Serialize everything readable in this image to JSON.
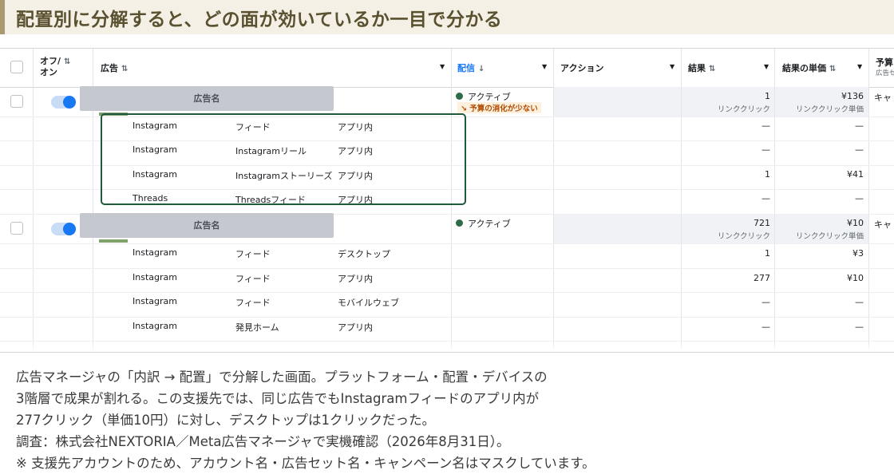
{
  "heading": "配置別に分解すると、どの面が効いているか一目で分かる",
  "columns": {
    "onoff": "オフ/\nオン",
    "onoff_line1": "オフ/",
    "onoff_line2": "オン",
    "ad": "広告",
    "delivery": "配信",
    "action": "アクション",
    "results": "結果",
    "cost_per_result": "結果の単価",
    "budget": "予算",
    "budget_sub": "広告セ"
  },
  "ads": [
    {
      "name": "広告名",
      "status": "アクティブ",
      "warning": "予算の消化が少ない",
      "result": "1",
      "result_unit": "リンククリック",
      "cost": "¥136",
      "cost_unit": "リンククリック単価",
      "budget": "キャ",
      "rows": [
        {
          "platform": "Instagram",
          "placement": "フィード",
          "device": "アプリ内",
          "result": "—",
          "cost": "—"
        },
        {
          "platform": "Instagram",
          "placement": "Instagramリール",
          "device": "アプリ内",
          "result": "—",
          "cost": "—"
        },
        {
          "platform": "Instagram",
          "placement": "Instagramストーリーズ",
          "device": "アプリ内",
          "result": "1",
          "cost": "¥41"
        },
        {
          "platform": "Threads",
          "placement": "Threadsフィード",
          "device": "アプリ内",
          "result": "—",
          "cost": "—"
        }
      ]
    },
    {
      "name": "広告名",
      "status": "アクティブ",
      "result": "721",
      "result_unit": "リンククリック",
      "cost": "¥10",
      "cost_unit": "リンククリック単価",
      "budget": "キャ",
      "rows": [
        {
          "platform": "Instagram",
          "placement": "フィード",
          "device": "デスクトップ",
          "result": "1",
          "cost": "¥3"
        },
        {
          "platform": "Instagram",
          "placement": "フィード",
          "device": "アプリ内",
          "result": "277",
          "cost": "¥10"
        },
        {
          "platform": "Instagram",
          "placement": "フィード",
          "device": "モバイルウェブ",
          "result": "—",
          "cost": "—"
        },
        {
          "platform": "Instagram",
          "placement": "発見ホーム",
          "device": "アプリ内",
          "result": "—",
          "cost": "—"
        }
      ]
    }
  ],
  "caption": [
    "広告マネージャの「内訳 → 配置」で分解した画面。プラットフォーム・配置・デバイスの",
    "3階層で成果が割れる。この支援先では、同じ広告でもInstagramフィードのアプリ内が",
    "277クリック（単価10円）に対し、デスクトップは1クリックだった。",
    "調査：株式会社NEXTORIA／Meta広告マネージャで実機確認（2026年8月31日）。",
    "※ 支援先アカウントのため、アカウント名・広告セット名・キャンペーン名はマスクしています。"
  ],
  "colors": {
    "accent_blue": "#1877f2",
    "highlight_green": "#1f5a3d",
    "status_green": "#2e6b4a",
    "heading_bg": "#f5f0e6"
  }
}
